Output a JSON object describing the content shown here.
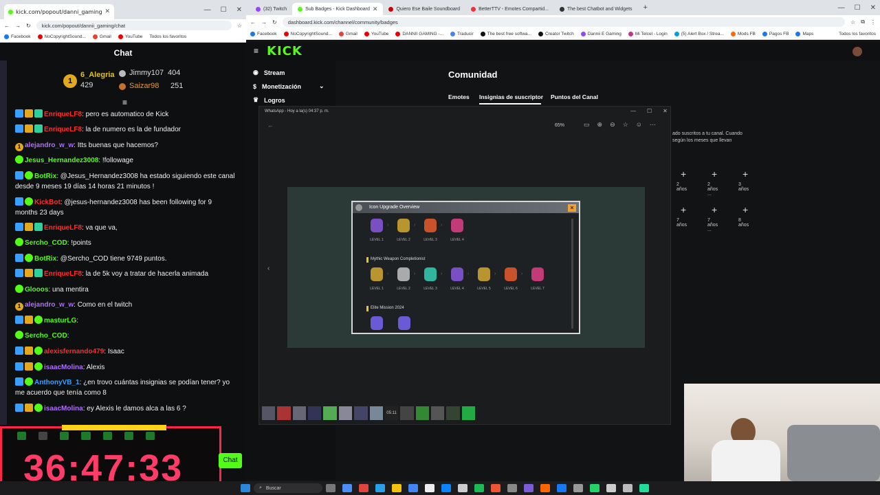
{
  "left_browser": {
    "tab_title": "kick.com/popout/danni_gaming",
    "url": "kick.com/popout/dannii_gaming/chat",
    "bookmarks": [
      "Facebook",
      "NoCopyrightSound...",
      "Gmail",
      "YouTube"
    ],
    "bookmark_folder": "Todos los favoritos",
    "chat_title": "Chat",
    "leaderboard": [
      {
        "rank": "1",
        "name": "6_Alegria",
        "points": "429"
      },
      {
        "rank": "",
        "name": "Jimmy107",
        "points": "404"
      },
      {
        "rank": "",
        "name": "Saizar98",
        "points": "251"
      }
    ],
    "messages": [
      {
        "user": "EnriqueLF8",
        "color": "#ff2d2d",
        "text": ": pero es automatico de Kick"
      },
      {
        "user": "EnriqueLF8",
        "color": "#ff2d2d",
        "text": ": la de numero es la de fundador"
      },
      {
        "user": "alejandro_w_w",
        "color": "#b06cff",
        "text": ": Itts buenas que hacemos?"
      },
      {
        "user": "Jesus_Hernandez3008",
        "color": "#53fc18",
        "text": ": !followage"
      },
      {
        "user": "BotRix",
        "color": "#53fc18",
        "text": ": @Jesus_Hernandez3008 ha estado siguiendo este canal desde 9 meses 19 días 14 horas 21 minutos !"
      },
      {
        "user": "KickBot",
        "color": "#ff2d2d",
        "text": ": @jesus-hernandez3008 has been following for 9 months 23 days"
      },
      {
        "user": "EnriqueLF8",
        "color": "#ff2d2d",
        "text": ": va que va,"
      },
      {
        "user": "Sercho_COD",
        "color": "#53fc18",
        "text": ": !points"
      },
      {
        "user": "BotRix",
        "color": "#53fc18",
        "text": ": @Sercho_COD tiene 9749 puntos."
      },
      {
        "user": "EnriqueLF8",
        "color": "#ff2d2d",
        "text": ": la de 5k voy a tratar de hacerla animada"
      },
      {
        "user": "Glooos",
        "color": "#53fc18",
        "text": ": una mentira"
      },
      {
        "user": "alejandro_w_w",
        "color": "#b06cff",
        "text": ": Como en el twitch"
      },
      {
        "user": "masturLG",
        "color": "#53fc18",
        "text": ":"
      },
      {
        "user": "Sercho_COD",
        "color": "#53fc18",
        "text": ":"
      },
      {
        "user": "alexisfernando479",
        "color": "#ff2d2d",
        "text": ": Isaac"
      },
      {
        "user": "isaacMolina",
        "color": "#b06cff",
        "text": ": Alexis"
      },
      {
        "user": "AnthonyVB_1",
        "color": "#3aa0ff",
        "text": ": ¿en trovo cuántas insignias se podían tener? yo me acuerdo que tenía como 8"
      },
      {
        "user": "isaacMolina",
        "color": "#b06cff",
        "text": ": ey Alexis le damos alca a las 6 ?"
      }
    ],
    "chat_button": "Chat",
    "timer": "36:47:33"
  },
  "right_browser": {
    "tabs": [
      "(32) Twitch",
      "Sub Badges - Kick Dashboard",
      "Quiero Ese Baile Soundboard",
      "BetterTTV - Emotes Compartid...",
      "The best Chatbot and Widgets"
    ],
    "url": "dashboard.kick.com/channel/community/badges",
    "bookmarks": [
      "Facebook",
      "NoCopyrightSound...",
      "Gmail",
      "YouTube",
      "DANNII GAMING -...",
      "Traducir",
      "The best free softwa...",
      "Creator Twitch",
      "Dannii E Gaming",
      "Mi Telcel - Login",
      "(5) Alert Box / Strea...",
      "Mods FB",
      "Pagos FB",
      "Maps"
    ],
    "bookmark_folder": "Todos los favoritos",
    "logo": "KICK",
    "sidebar": [
      "Stream",
      "Monetización",
      "Logros"
    ],
    "heading": "Comunidad",
    "tabs_nav": [
      "Emotes",
      "Insignias de suscriptor",
      "Puntos del Canal"
    ],
    "description": "ado suscritos a tu canal. Cuando según los meses que llevan",
    "badge_slots": [
      "2 años",
      "2 años ...",
      "3 años",
      "7 años",
      "7 años ...",
      "8 años"
    ]
  },
  "whatsapp_viewer": {
    "title": "WhatsApp - Hoy a la(s) 04:37 p. m.",
    "zoom": "65%",
    "dialog_title": "Icon Upgrade Overview",
    "row1_levels": [
      "LEVEL 1",
      "LEVEL 2",
      "LEVEL 3",
      "LEVEL 4"
    ],
    "section2_title": "Mythic Weapon Completionist",
    "row2_levels": [
      "LEVEL 1",
      "LEVEL 2",
      "LEVEL 3",
      "LEVEL 4",
      "LEVEL 5",
      "LEVEL 6",
      "LEVEL 7"
    ],
    "section3_title": "Elite Mission 2024",
    "thumb_time": "05:11"
  },
  "taskbar": {
    "search_placeholder": "Buscar"
  },
  "colors": {
    "kick_green": "#53fc18",
    "timer_red": "#ff3b68"
  }
}
